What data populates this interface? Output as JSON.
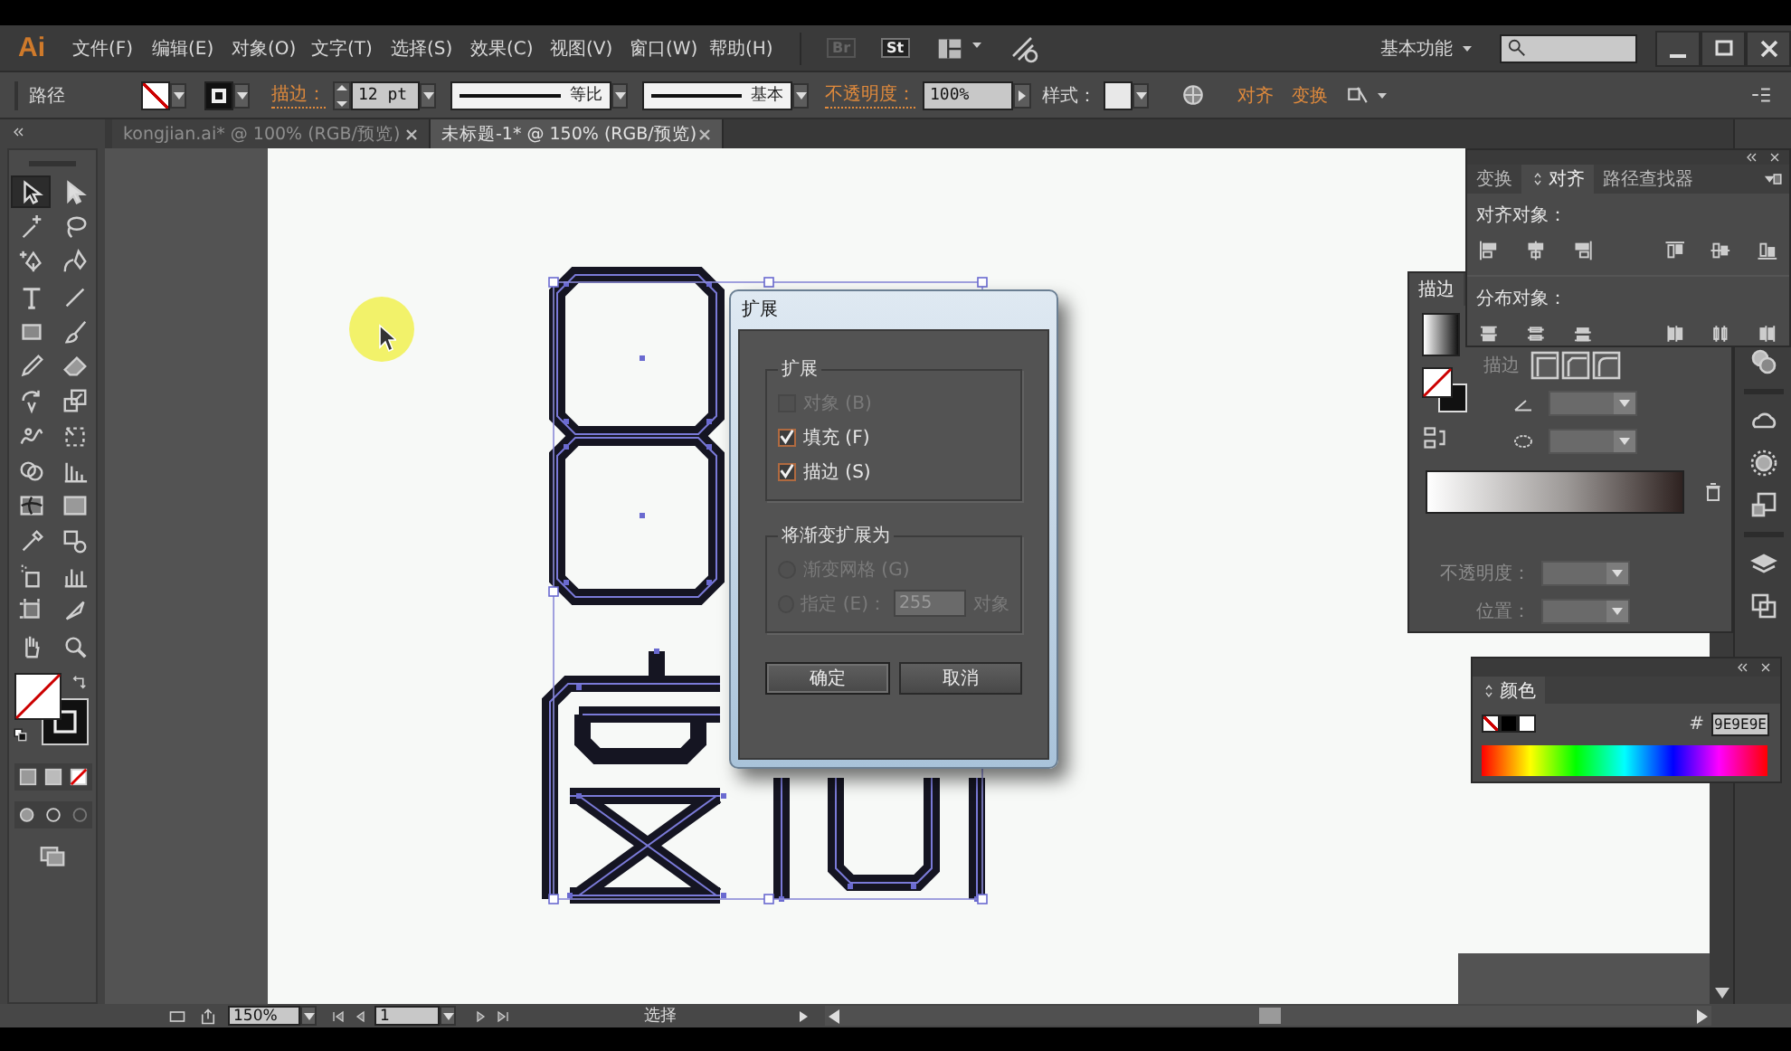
{
  "menu_bar": {
    "app_logo": "Ai",
    "items": [
      "文件(F)",
      "编辑(E)",
      "对象(O)",
      "文字(T)",
      "选择(S)",
      "效果(C)",
      "视图(V)",
      "窗口(W)",
      "帮助(H)"
    ],
    "bridge_badge": "Br",
    "stock_badge": "St",
    "workspace": "基本功能"
  },
  "control_bar": {
    "selection_label": "路径",
    "stroke_label": "描边：",
    "stroke_weight": "12 pt",
    "profile_label": "等比",
    "brush_label": "基本",
    "opacity_label": "不透明度：",
    "opacity_value": "100%",
    "style_label": "样式：",
    "align_link": "对齐",
    "transform_link": "变换"
  },
  "document_tabs": [
    {
      "label": "kongjian.ai* @ 100% (RGB/预览)",
      "selected": false
    },
    {
      "label": "未标题-1* @ 150% (RGB/预览)",
      "selected": true
    }
  ],
  "toolbox": {
    "tools": [
      {
        "selected": true
      },
      {
        "selected": false
      },
      {
        "selected": false
      },
      {
        "selected": false
      },
      {
        "selected": false
      },
      {
        "selected": false
      },
      {
        "selected": false
      },
      {
        "selected": false
      },
      {
        "selected": false
      },
      {
        "selected": false
      },
      {
        "selected": false
      },
      {
        "selected": false
      },
      {
        "selected": false
      },
      {
        "selected": false
      },
      {
        "selected": false
      },
      {
        "selected": false
      },
      {
        "selected": false
      },
      {
        "selected": false
      },
      {
        "selected": false
      },
      {
        "selected": false
      },
      {
        "selected": false
      },
      {
        "selected": false
      },
      {
        "selected": false
      },
      {
        "selected": false
      },
      {
        "selected": false
      },
      {
        "selected": false
      },
      {
        "selected": false
      },
      {
        "selected": false
      }
    ]
  },
  "dialog": {
    "title": "扩展",
    "expand_group": {
      "title": "扩展",
      "options": [
        {
          "label": "对象 (B)",
          "checked": false,
          "disabled": true
        },
        {
          "label": "填充 (F)",
          "checked": true,
          "disabled": false
        },
        {
          "label": "描边 (S)",
          "checked": true,
          "disabled": false
        }
      ]
    },
    "gradient_group": {
      "title": "将渐变扩展为",
      "options": [
        {
          "label": "渐变网格 (G)",
          "selected": false,
          "disabled": true
        },
        {
          "label": "指定 (E)：",
          "selected": false,
          "disabled": true,
          "value": "255",
          "suffix": "对象"
        }
      ]
    },
    "buttons": [
      "确定",
      "取消"
    ]
  },
  "align_panel": {
    "tabs": [
      {
        "label": "变换",
        "selected": false
      },
      {
        "label": "对齐",
        "selected": true
      },
      {
        "label": "路径查找器",
        "selected": false
      }
    ],
    "align_objects_label": "对齐对象：",
    "distribute_objects_label": "分布对象："
  },
  "gradient_panel": {
    "tab": "描边",
    "stroke_label": "描边",
    "opacity_label": "不透明度：",
    "position_label": "位置："
  },
  "color_panel": {
    "title": "颜色",
    "hex_label": "#",
    "hex_value": "9E9E9E"
  },
  "status_bar": {
    "zoom": "150%",
    "page": "1",
    "tool": "选择"
  }
}
